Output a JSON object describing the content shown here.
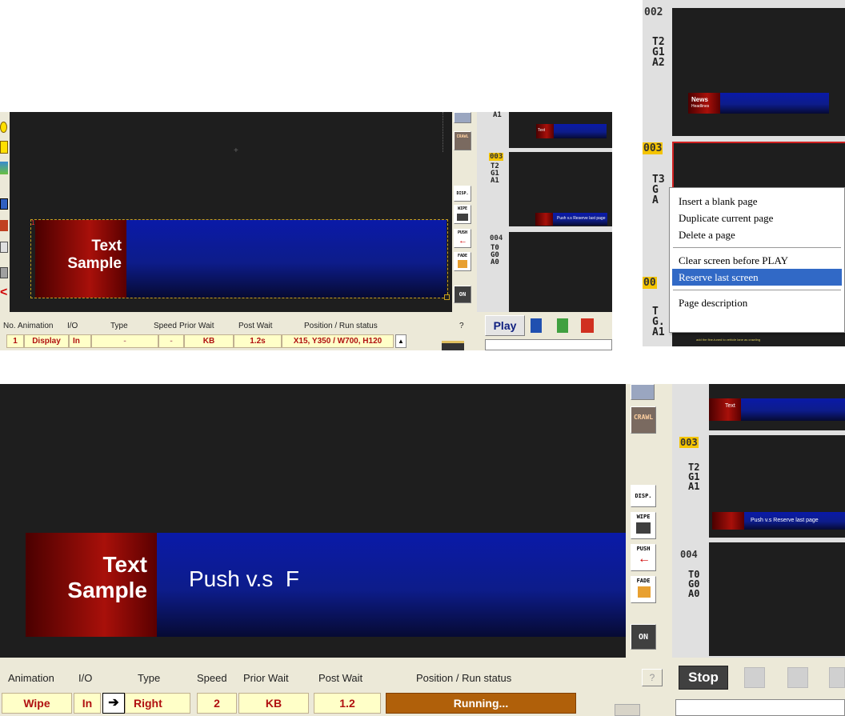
{
  "top_left": {
    "banner_text": [
      "Text",
      "Sample"
    ],
    "table": {
      "headers": [
        "No.",
        "Animation",
        "I/O",
        "Type",
        "Speed",
        "Prior Wait",
        "Post Wait",
        "Position / Run status",
        "?"
      ],
      "row": {
        "no": "1",
        "animation": "Display",
        "io": "In",
        "type": "-",
        "speed": "-",
        "prior_wait": "KB",
        "post_wait": "1.2s",
        "position": "X15, Y350 / W700, H120"
      }
    },
    "play_label": "Play"
  },
  "toolbar_icons": {
    "crawl": "CRAWL",
    "disp": "DISP.",
    "wipe": "WIPE",
    "push": "PUSH",
    "fade": "FADE",
    "on": "ON"
  },
  "pages": [
    {
      "num": "003",
      "t": "T2",
      "g": "G1",
      "a": "A1",
      "mini_title": "Text Sample",
      "mini_body": "Push v.s Reserve last page"
    },
    {
      "num": "004",
      "t": "T0",
      "g": "G0",
      "a": "A0"
    }
  ],
  "top_partial_tga": "A1",
  "right_panel": {
    "page_002": {
      "num": "002",
      "t": "T2",
      "g": "G1",
      "a": "A2",
      "mini_title": "News",
      "mini_sub": "Headlines"
    },
    "page_003": {
      "num": "003",
      "t": "T3",
      "g": "G",
      "a": "A"
    },
    "page_partial": {
      "num": "00",
      "t": "T",
      "g": "G.",
      "a": "A1"
    },
    "context_menu": [
      "Insert a blank page",
      "Duplicate current page",
      "Delete a page",
      "Clear screen before PLAY",
      "Reserve last screen",
      "Page description"
    ],
    "highlighted_index": 4,
    "tiny_caption": "add the fine-tuned to vehicle lane as crawling"
  },
  "bottom": {
    "banner_text": [
      "Text",
      "Sample"
    ],
    "body_text": "Push v.s  F",
    "table": {
      "headers": [
        "Animation",
        "I/O",
        "Type",
        "Speed",
        "Prior Wait",
        "Post Wait",
        "Position / Run status",
        "?"
      ],
      "row": {
        "animation": "Wipe",
        "io": "In",
        "type": "Right",
        "speed": "2",
        "prior_wait": "KB",
        "post_wait": "1.2",
        "position": "Running..."
      }
    },
    "stop_label": "Stop"
  },
  "colors": {
    "accent_yellow": "#f4c400",
    "highlight": "#3169c6",
    "banner_red": "#a8100a",
    "banner_blue": "#0a1aa8",
    "running": "#b0600a"
  }
}
